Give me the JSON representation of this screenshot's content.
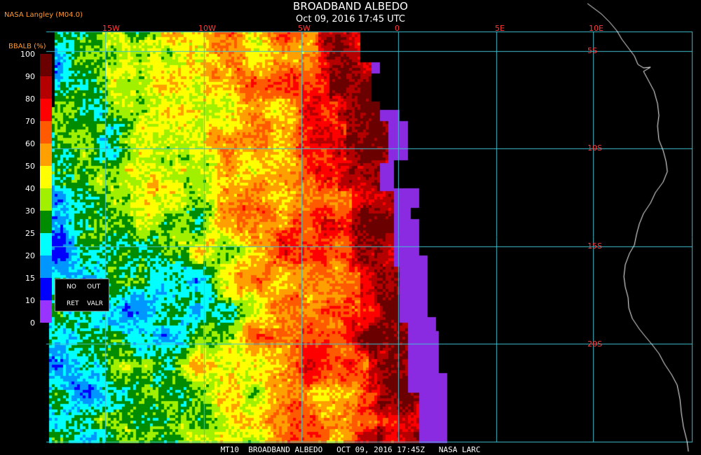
{
  "header": {
    "title": "BROADBAND ALBEDO",
    "subtitle": "Oct 09, 2016 17:45 UTC",
    "credit": "NASA Langley (M04.0)"
  },
  "legend": {
    "title": "BBALB (%)",
    "bins": [
      {
        "label": "100",
        "color": "#6a0000"
      },
      {
        "label": "90",
        "color": "#b40000"
      },
      {
        "label": "80",
        "color": "#ff0000"
      },
      {
        "label": "70",
        "color": "#ff5a00"
      },
      {
        "label": "60",
        "color": "#ffa000"
      },
      {
        "label": "50",
        "color": "#ffff00"
      },
      {
        "label": "40",
        "color": "#a0f000"
      },
      {
        "label": "30",
        "color": "#008c00"
      },
      {
        "label": "25",
        "color": "#00ffff"
      },
      {
        "label": "20",
        "color": "#0096ff"
      },
      {
        "label": "15",
        "color": "#0000ff"
      },
      {
        "label": "10",
        "color": "#9933ff"
      },
      {
        "label": "0",
        "color": null
      }
    ],
    "no_data": {
      "line1_a": "NO",
      "line1_b": "OUT",
      "line2_a": "RET",
      "line2_b": "VALR"
    }
  },
  "grid": {
    "lon_labels": [
      "15W",
      "10W",
      "5W",
      "0",
      "5E",
      "10E"
    ],
    "lat_labels": [
      "5S",
      "10S",
      "15S",
      "20S"
    ],
    "color": "#40c0d0"
  },
  "footer": "MT10  BROADBAND ALBEDO   OCT 09, 2016 17:45Z   NASA LARC",
  "colors": {
    "background": "#000000",
    "no_retrieval": "#8a2be2",
    "coastline": "#ffffff",
    "grid_label": "#ff3b3b",
    "credit": "#ff9933"
  }
}
